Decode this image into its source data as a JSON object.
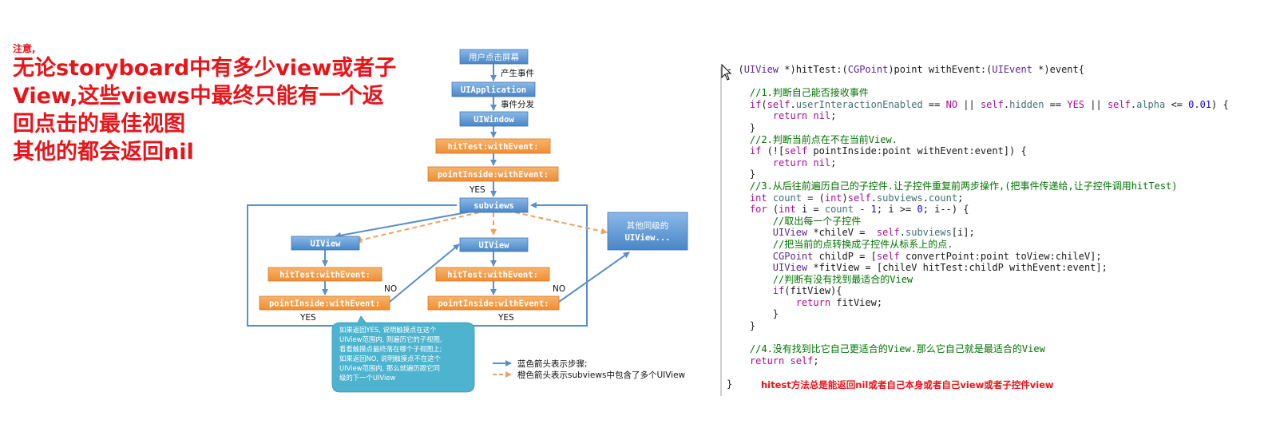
{
  "note": {
    "title": "注意,",
    "lines": [
      "无论storyboard中有多少view或者子",
      "View,这些views中最终只能有一个返",
      "回点击的最佳视图",
      "其他的都会返回nil"
    ]
  },
  "diagram": {
    "boxes": {
      "screen": "用户点击屏幕",
      "app": "UIApplication",
      "window": "UIWindow",
      "hittest_top": "hitTest:withEvent:",
      "pointinside_top": "pointInside:withEvent:",
      "subviews": "subviews",
      "uiview_left": "UIView",
      "hittest_left": "hitTest:withEvent:",
      "pointinside_left": "pointInside:withEvent:",
      "uiview_mid": "UIView",
      "hittest_mid": "hitTest:withEvent:",
      "pointinside_mid": "pointInside:withEvent:",
      "other_line1": "其他同级的",
      "other_line2": "UIView..."
    },
    "side_labels": {
      "produce_event": "产生事件",
      "dispatch_event": "事件分发",
      "yes_top": "YES",
      "no_left": "NO",
      "yes_left": "YES",
      "no_mid": "NO",
      "yes_mid": "YES"
    },
    "bubble_lines": [
      "如果返回YES, 说明触摸点在这个",
      "UIView范围内, 则遍历它的子视图,",
      "看看触摸点最终落在哪个子视图上;",
      "如果返回NO, 说明触摸点不在这个",
      "UIView范围内, 那么就遍历跟它同",
      "级的下一个UIView"
    ],
    "legend": {
      "blue": "蓝色箭头表示步骤;",
      "orange": "橙色箭头表示subviews中包含了多个UIView"
    },
    "colors": {
      "blue_box": "#5b9bd5",
      "orange_box": "#f5a04c",
      "teal_bubble": "#4db3cf",
      "blue_arrow": "#5b8fc9",
      "orange_arrow": "#f0a060"
    }
  },
  "code": {
    "lines": [
      "- (UIView *)hitTest:(CGPoint)point withEvent:(UIEvent *)event{",
      "",
      "    //1.判断自己能否接收事件",
      "    if(self.userInteractionEnabled == NO || self.hidden == YES || self.alpha <= 0.01) {",
      "        return nil;",
      "    }",
      "    //2.判断当前点在不在当前View.",
      "    if (![self pointInside:point withEvent:event]) {",
      "        return nil;",
      "    }",
      "    //3.从后往前遍历自己的子控件.让子控件重复前两步操作,(把事件传递给,让子控件调用hitTest)",
      "    int count = (int)self.subviews.count;",
      "    for (int i = count - 1; i >= 0; i--) {",
      "        //取出每一个子控件",
      "        UIView *chileV =  self.subviews[i];",
      "        //把当前的点转换成子控件从标系上的点.",
      "        CGPoint childP = [self convertPoint:point toView:chileV];",
      "        UIView *fitView = [chileV hitTest:childP withEvent:event];",
      "        //判断有没有找到最适合的View",
      "        if(fitView){",
      "            return fitView;",
      "        }",
      "    }",
      "",
      "    //4.没有找到比它自己更适合的View.那么它自己就是最适合的View",
      "    return self;",
      "",
      "}"
    ]
  },
  "footer_note": "hitest方法总是能返回nil或者自己本身或者自己view或者子控件view"
}
